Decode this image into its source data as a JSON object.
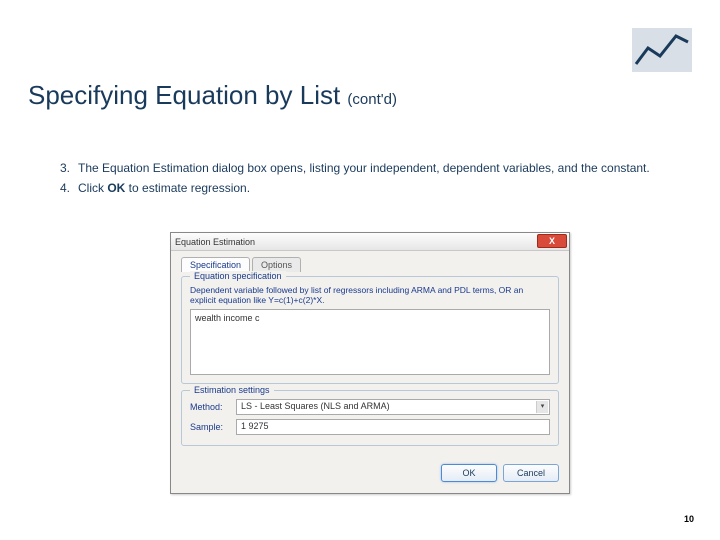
{
  "title": {
    "main": "Specifying Equation by List ",
    "sub": "(cont'd)"
  },
  "steps": [
    {
      "num": "3.",
      "text": "The Equation Estimation dialog box opens, listing your independent, dependent variables, and the constant."
    },
    {
      "num": "4.",
      "text_before": "Click ",
      "bold": "OK",
      "text_after": " to estimate regression."
    }
  ],
  "dialog": {
    "title": "Equation Estimation",
    "close": "X",
    "tabs": {
      "spec": "Specification",
      "options": "Options"
    },
    "spec_group": {
      "legend": "Equation specification",
      "hint": "Dependent variable followed by list of regressors including ARMA and PDL terms, OR an explicit equation like Y=c(1)+c(2)*X.",
      "equation": "wealth income c"
    },
    "est_group": {
      "legend": "Estimation settings",
      "method_label": "Method:",
      "method_value": "LS - Least Squares (NLS and ARMA)",
      "sample_label": "Sample:",
      "sample_value": "1 9275"
    },
    "buttons": {
      "ok": "OK",
      "cancel": "Cancel"
    }
  },
  "pagenum": "10"
}
